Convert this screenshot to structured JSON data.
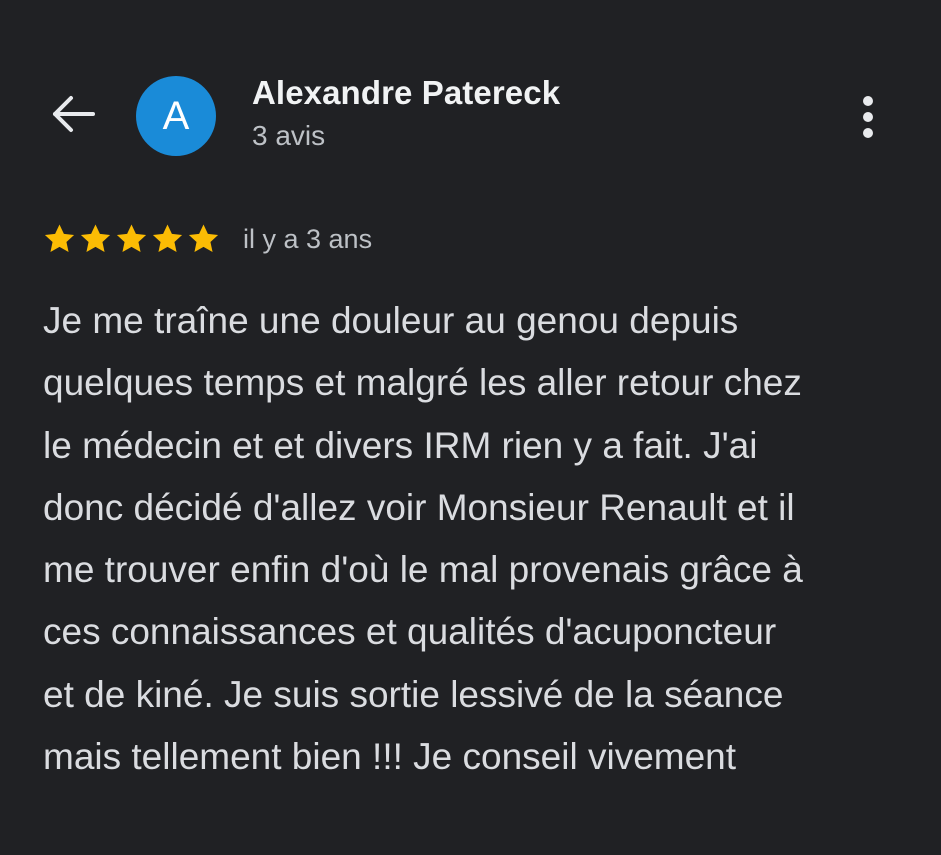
{
  "header": {
    "user_name": "Alexandre Patereck",
    "review_count": "3 avis",
    "avatar_initial": "A",
    "avatar_color": "#1a8bd8",
    "back_icon": "arrow-back-icon",
    "more_icon": "more-vert-icon"
  },
  "review": {
    "rating": 5,
    "max_rating": 5,
    "star_color": "#fbbc04",
    "date": "il y a 3 ans",
    "lines": [
      "Je me traîne une douleur au genou depuis",
      "quelques temps et malgré les aller retour chez",
      "le médecin et et divers IRM rien y a fait. J'ai",
      "donc décidé d'allez voir Monsieur Renault et il",
      "me trouver enfin d'où le mal provenais grâce à",
      "ces connaissances et qualités d'acuponcteur",
      "et de kiné. Je suis sortie lessivé de la séance",
      "mais tellement bien !!! Je conseil vivement"
    ]
  }
}
